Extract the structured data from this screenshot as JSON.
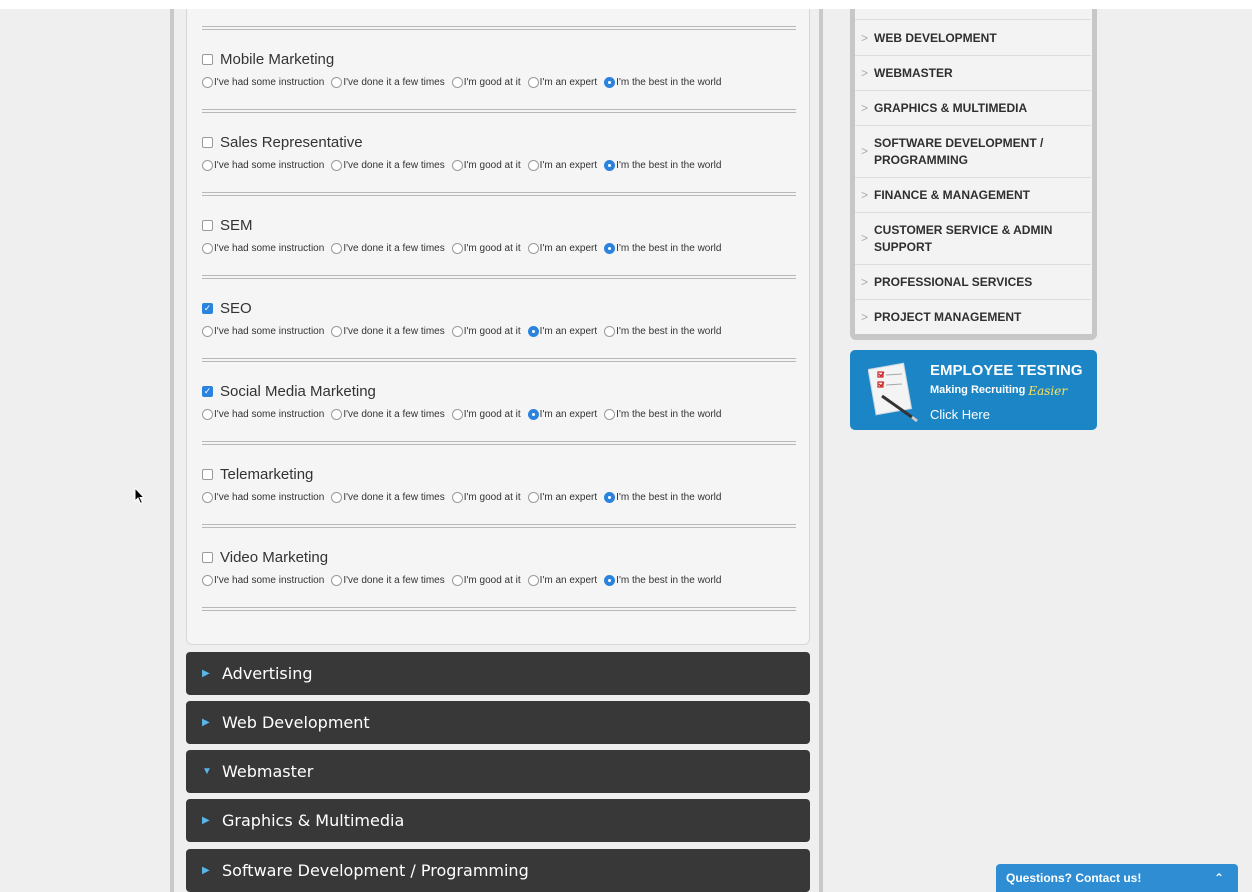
{
  "level_options": [
    "I've had some instruction",
    "I've done it a few times",
    "I'm good at it",
    "I'm an expert",
    "I'm the best in the world"
  ],
  "skills": [
    {
      "name": "Mobile Marketing",
      "checked": false,
      "selected_level": 4
    },
    {
      "name": "Sales Representative",
      "checked": false,
      "selected_level": 4
    },
    {
      "name": "SEM",
      "checked": false,
      "selected_level": 4
    },
    {
      "name": "SEO",
      "checked": true,
      "selected_level": 3
    },
    {
      "name": "Social Media Marketing",
      "checked": true,
      "selected_level": 3
    },
    {
      "name": "Telemarketing",
      "checked": false,
      "selected_level": 4
    },
    {
      "name": "Video Marketing",
      "checked": false,
      "selected_level": 4
    }
  ],
  "accordion": [
    {
      "label": "Advertising",
      "expanded": false
    },
    {
      "label": "Web Development",
      "expanded": false
    },
    {
      "label": "Webmaster",
      "expanded": true
    },
    {
      "label": "Graphics & Multimedia",
      "expanded": false
    },
    {
      "label": "Software Development / Programming",
      "expanded": false
    }
  ],
  "sidebar": {
    "items": [
      "WEB DEVELOPMENT",
      "WEBMASTER",
      "GRAPHICS & MULTIMEDIA",
      "SOFTWARE DEVELOPMENT / PROGRAMMING",
      "FINANCE & MANAGEMENT",
      "CUSTOMER SERVICE & ADMIN SUPPORT",
      "PROFESSIONAL SERVICES",
      "PROJECT MANAGEMENT"
    ]
  },
  "ad": {
    "title": "EMPLOYEE TESTING",
    "subtitle": "Making Recruiting",
    "subtitle_script": "Easier",
    "cta": "Click Here"
  },
  "chat": {
    "label": "Questions? Contact us!"
  },
  "colors": {
    "accent": "#2b83de",
    "dark_bar": "#383838",
    "ad_bg": "#1c85c6"
  },
  "icons": {
    "chevron": "chevron-right-icon",
    "chat_toggle": "chevron-up-icon"
  }
}
